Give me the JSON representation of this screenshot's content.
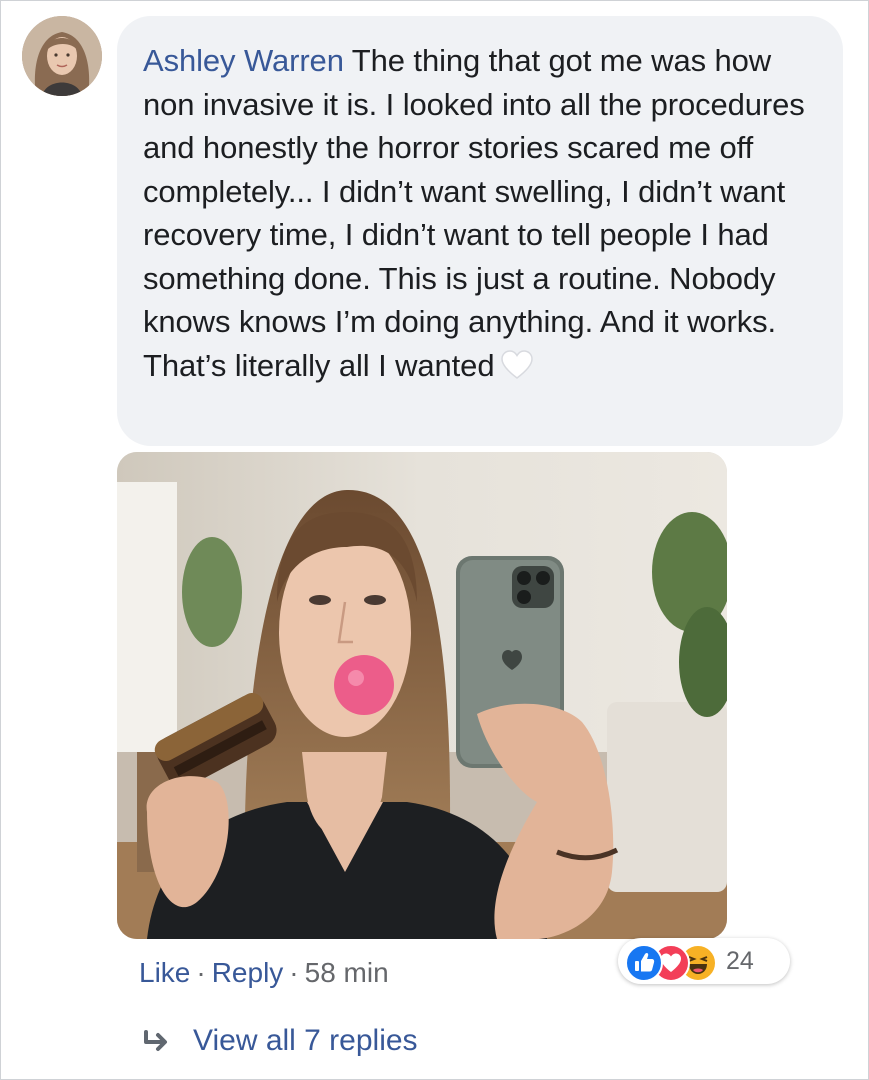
{
  "comment": {
    "author": "Ashley Warren",
    "text": "The thing that got me was how non invasive it is. I looked into all the procedures and honestly the horror stories scared me off completely... I didn’t want swelling, I didn’t want recovery time, I didn’t want to tell people I had something done. This is just a routine. Nobody knows knows I’m doing anything. And it works. That’s literally all I wanted",
    "emoji_icon": "white-heart-icon"
  },
  "actions": {
    "like_label": "Like",
    "separator": "·",
    "reply_label": "Reply",
    "timestamp": "58 min"
  },
  "reactions": {
    "icons": [
      "like-icon",
      "love-icon",
      "haha-icon"
    ],
    "count": "24"
  },
  "replies": {
    "view_label": "View all 7 replies",
    "icon": "reply-arrow-icon"
  },
  "colors": {
    "author_link": "#385898",
    "bubble_bg": "#f0f2f5",
    "like_blue": "#1877f2",
    "love_red": "#f33e58",
    "haha_yellow": "#f7b125",
    "meta_gray": "#65676b"
  }
}
